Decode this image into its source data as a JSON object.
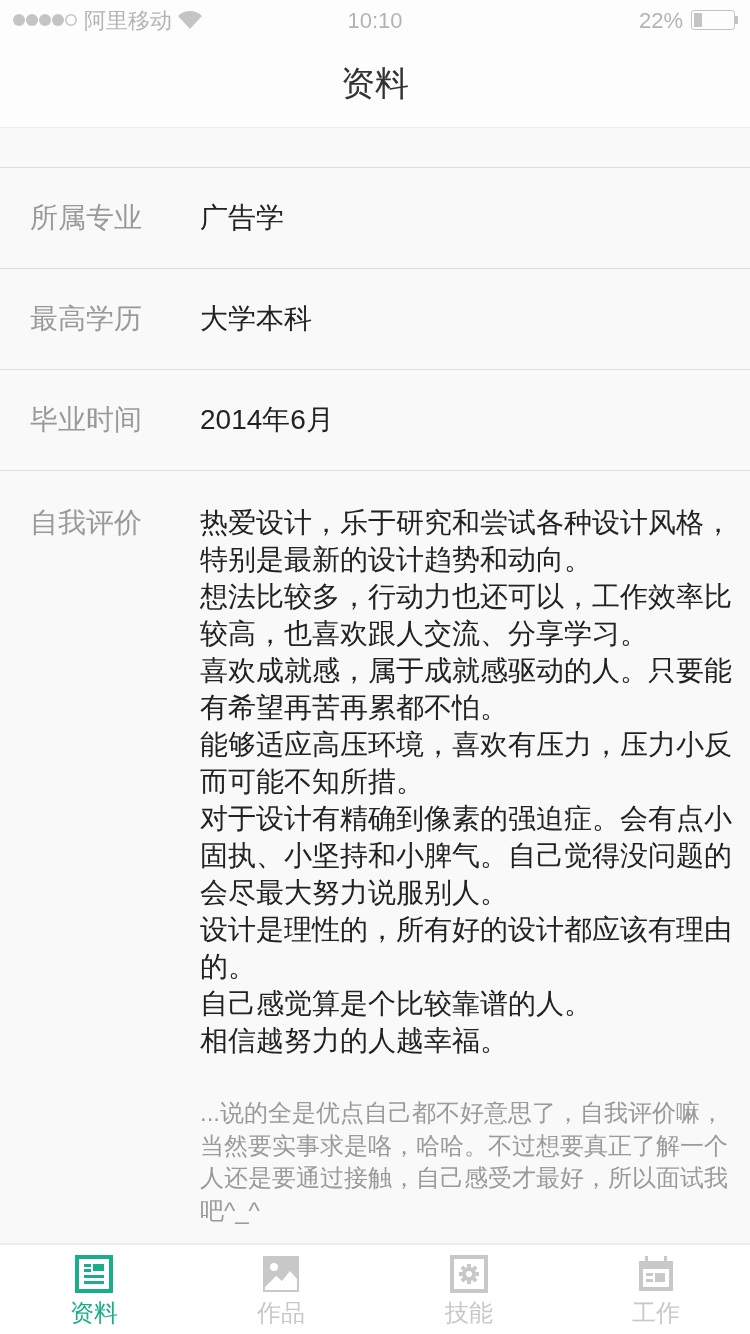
{
  "status_bar": {
    "carrier": "阿里移动",
    "time": "10:10",
    "battery": {
      "text": "22%",
      "level": 0.22
    }
  },
  "nav": {
    "title": "资料"
  },
  "fields": [
    {
      "label": "所属专业",
      "value": "广告学"
    },
    {
      "label": "最高学历",
      "value": "大学本科"
    },
    {
      "label": "毕业时间",
      "value": "2014年6月"
    }
  ],
  "self_evaluation": {
    "label": "自我评价",
    "paragraphs": [
      "热爱设计，乐于研究和尝试各种设计风格，特别是最新的设计趋势和动向。",
      "想法比较多，行动力也还可以，工作效率比较高，也喜欢跟人交流、分享学习。",
      "喜欢成就感，属于成就感驱动的人。只要能有希望再苦再累都不怕。",
      "能够适应高压环境，喜欢有压力，压力小反而可能不知所措。",
      "对于设计有精确到像素的强迫症。会有点小固执、小坚持和小脾气。自己觉得没问题的会尽最大努力说服别人。",
      "设计是理性的，所有好的设计都应该有理由的。",
      "自己感觉算是个比较靠谱的人。",
      "相信越努力的人越幸福。"
    ],
    "note": "...说的全是优点自己都不好意思了，自我评价嘛，当然要实事求是咯，哈哈。不过想要真正了解一个人还是要通过接触，自己感受才最好，所以面试我吧^_^"
  },
  "tab_bar": [
    {
      "kind": "profile",
      "label": "资料",
      "selected": true
    },
    {
      "kind": "works",
      "label": "作品",
      "selected": false
    },
    {
      "kind": "skills",
      "label": "技能",
      "selected": false
    },
    {
      "kind": "work",
      "label": "工作",
      "selected": false
    }
  ]
}
